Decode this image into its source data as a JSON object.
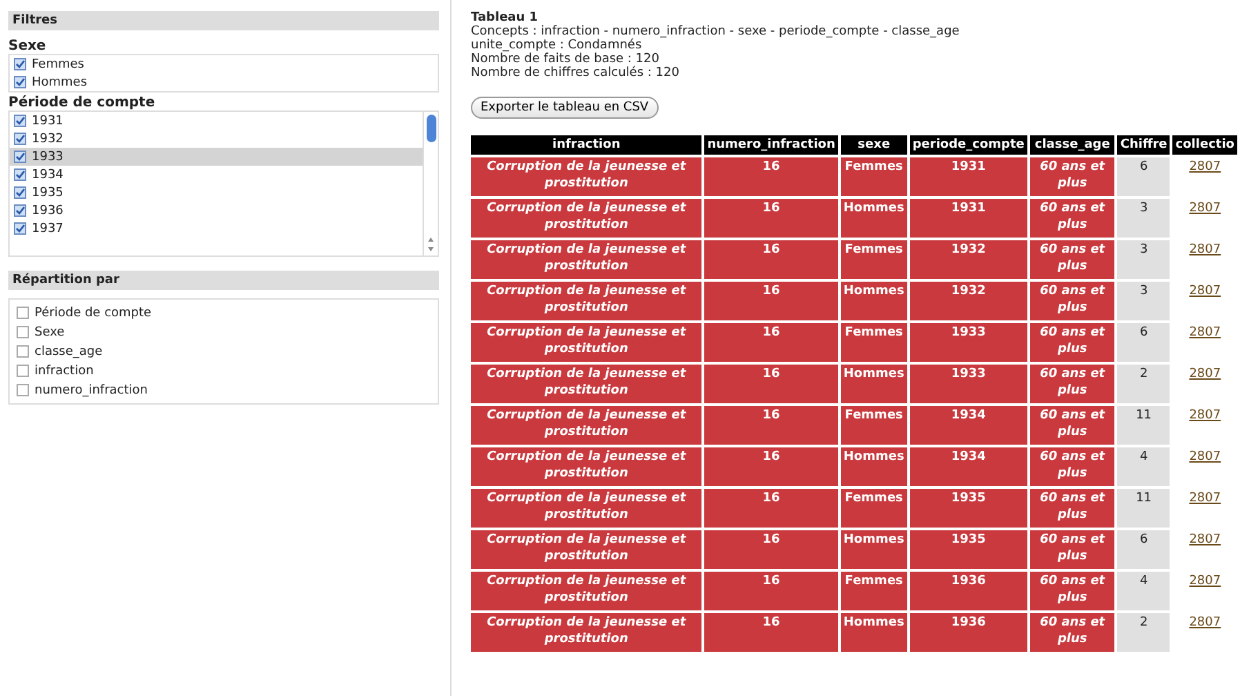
{
  "filters": {
    "title": "Filtres",
    "groups": [
      {
        "label": "Sexe",
        "scroll": false,
        "items": [
          {
            "label": "Femmes",
            "checked": true,
            "selected": false
          },
          {
            "label": "Hommes",
            "checked": true,
            "selected": false
          }
        ]
      },
      {
        "label": "Période de compte",
        "scroll": true,
        "items": [
          {
            "label": "1931",
            "checked": true,
            "selected": false
          },
          {
            "label": "1932",
            "checked": true,
            "selected": false
          },
          {
            "label": "1933",
            "checked": true,
            "selected": true
          },
          {
            "label": "1934",
            "checked": true,
            "selected": false
          },
          {
            "label": "1935",
            "checked": true,
            "selected": false
          },
          {
            "label": "1936",
            "checked": true,
            "selected": false
          },
          {
            "label": "1937",
            "checked": true,
            "selected": false
          }
        ]
      }
    ]
  },
  "repartition": {
    "title": "Répartition par",
    "items": [
      {
        "label": "Période de compte",
        "checked": false
      },
      {
        "label": "Sexe",
        "checked": false
      },
      {
        "label": "classe_age",
        "checked": false
      },
      {
        "label": "infraction",
        "checked": false
      },
      {
        "label": "numero_infraction",
        "checked": false
      }
    ]
  },
  "info": {
    "title": "Tableau 1",
    "lines": [
      "Concepts : infraction - numero_infraction - sexe - periode_compte - classe_age",
      "unite_compte : Condamnés",
      "Nombre de faits de base : 120",
      "Nombre de chiffres calculés : 120"
    ]
  },
  "export_button": "Exporter le tableau en CSV",
  "table": {
    "columns": [
      "infraction",
      "numero_infraction",
      "sexe",
      "periode_compte",
      "classe_age",
      "Chiffre",
      "collectio"
    ],
    "rows": [
      [
        "Corruption de la jeunesse et prostitution",
        "16",
        "Femmes",
        "1931",
        "60 ans et plus",
        "6",
        "2807"
      ],
      [
        "Corruption de la jeunesse et prostitution",
        "16",
        "Hommes",
        "1931",
        "60 ans et plus",
        "3",
        "2807"
      ],
      [
        "Corruption de la jeunesse et prostitution",
        "16",
        "Femmes",
        "1932",
        "60 ans et plus",
        "3",
        "2807"
      ],
      [
        "Corruption de la jeunesse et prostitution",
        "16",
        "Hommes",
        "1932",
        "60 ans et plus",
        "3",
        "2807"
      ],
      [
        "Corruption de la jeunesse et prostitution",
        "16",
        "Femmes",
        "1933",
        "60 ans et plus",
        "6",
        "2807"
      ],
      [
        "Corruption de la jeunesse et prostitution",
        "16",
        "Hommes",
        "1933",
        "60 ans et plus",
        "2",
        "2807"
      ],
      [
        "Corruption de la jeunesse et prostitution",
        "16",
        "Femmes",
        "1934",
        "60 ans et plus",
        "11",
        "2807"
      ],
      [
        "Corruption de la jeunesse et prostitution",
        "16",
        "Hommes",
        "1934",
        "60 ans et plus",
        "4",
        "2807"
      ],
      [
        "Corruption de la jeunesse et prostitution",
        "16",
        "Femmes",
        "1935",
        "60 ans et plus",
        "11",
        "2807"
      ],
      [
        "Corruption de la jeunesse et prostitution",
        "16",
        "Hommes",
        "1935",
        "60 ans et plus",
        "6",
        "2807"
      ],
      [
        "Corruption de la jeunesse et prostitution",
        "16",
        "Femmes",
        "1936",
        "60 ans et plus",
        "4",
        "2807"
      ],
      [
        "Corruption de la jeunesse et prostitution",
        "16",
        "Hommes",
        "1936",
        "60 ans et plus",
        "2",
        "2807"
      ]
    ]
  }
}
